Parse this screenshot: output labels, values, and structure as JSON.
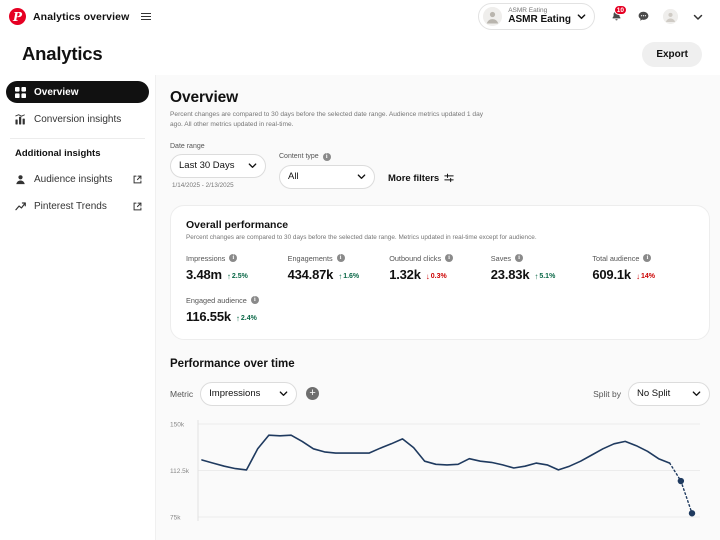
{
  "topbar": {
    "brand_title": "Analytics overview",
    "logo_letter": "P",
    "account": {
      "sub_label": "ASMR Eating",
      "name": "ASMR Eating"
    },
    "notifications_badge": "10"
  },
  "page_header": {
    "title": "Analytics",
    "export_label": "Export"
  },
  "sidebar": {
    "items": [
      {
        "label": "Overview",
        "icon": "grid-icon",
        "active": true
      },
      {
        "label": "Conversion insights",
        "icon": "bar-chart-icon",
        "active": false
      }
    ],
    "section_title": "Additional insights",
    "links": [
      {
        "label": "Audience insights",
        "icon": "person-icon"
      },
      {
        "label": "Pinterest Trends",
        "icon": "trend-arrow-icon"
      }
    ]
  },
  "overview": {
    "title": "Overview",
    "subtitle": "Percent changes are compared to 30 days before the selected date range. Audience metrics updated 1 day ago. All other metrics updated in real-time.",
    "filters": {
      "date_range_label": "Date range",
      "date_range_value": "Last 30 Days",
      "date_range_note": "1/14/2025 - 2/13/2025",
      "content_type_label": "Content type",
      "content_type_value": "All",
      "more_filters_label": "More filters"
    }
  },
  "overall_performance": {
    "title": "Overall performance",
    "subtitle": "Percent changes are compared to 30 days before the selected date range. Metrics updated in real-time except for audience.",
    "metrics": [
      {
        "label": "Impressions",
        "value": "3.48m",
        "delta": "2.5%",
        "direction": "up"
      },
      {
        "label": "Engagements",
        "value": "434.87k",
        "delta": "1.6%",
        "direction": "up"
      },
      {
        "label": "Outbound clicks",
        "value": "1.32k",
        "delta": "0.3%",
        "direction": "down"
      },
      {
        "label": "Saves",
        "value": "23.83k",
        "delta": "5.1%",
        "direction": "up"
      },
      {
        "label": "Total audience",
        "value": "609.1k",
        "delta": "14%",
        "direction": "down"
      }
    ],
    "metrics_row2": [
      {
        "label": "Engaged audience",
        "value": "116.55k",
        "delta": "2.4%",
        "direction": "up"
      }
    ]
  },
  "performance_over_time": {
    "title": "Performance over time",
    "metric_label": "Metric",
    "metric_value": "Impressions",
    "add_metric_label": "+",
    "split_label": "Split by",
    "split_value": "No Split"
  },
  "colors": {
    "brand_red": "#e60023",
    "line_navy": "#1f3a5f",
    "positive": "#0a6847",
    "negative": "#cc0000",
    "active_nav": "#111111"
  },
  "chart_data": {
    "type": "line",
    "title": "Performance over time",
    "xlabel": "",
    "ylabel": "Impressions",
    "ylim": [
      75000,
      150000
    ],
    "yticks": [
      150000,
      112500,
      75000
    ],
    "ytick_labels": [
      "150k",
      "112.5k",
      "75k"
    ],
    "grid": true,
    "legend": null,
    "series": [
      {
        "name": "Impressions",
        "color": "#1f3a5f",
        "style": "solid",
        "values": [
          121000,
          118500,
          116000,
          114000,
          113000,
          130000,
          141000,
          140500,
          141000,
          136000,
          130000,
          127500,
          126500,
          126500,
          126500,
          126500,
          130500,
          134000,
          138000,
          131000,
          120000,
          117500,
          117000,
          117500,
          122000,
          120000,
          119000,
          117000,
          114500,
          116000,
          118500,
          117000,
          113000,
          116000,
          120000,
          125000,
          130000,
          134000,
          136000,
          132500,
          128000,
          122000,
          118500
        ]
      },
      {
        "name": "Impressions (projected)",
        "color": "#1f3a5f",
        "style": "dotted",
        "values": [
          118500,
          104000,
          78000
        ]
      }
    ]
  }
}
